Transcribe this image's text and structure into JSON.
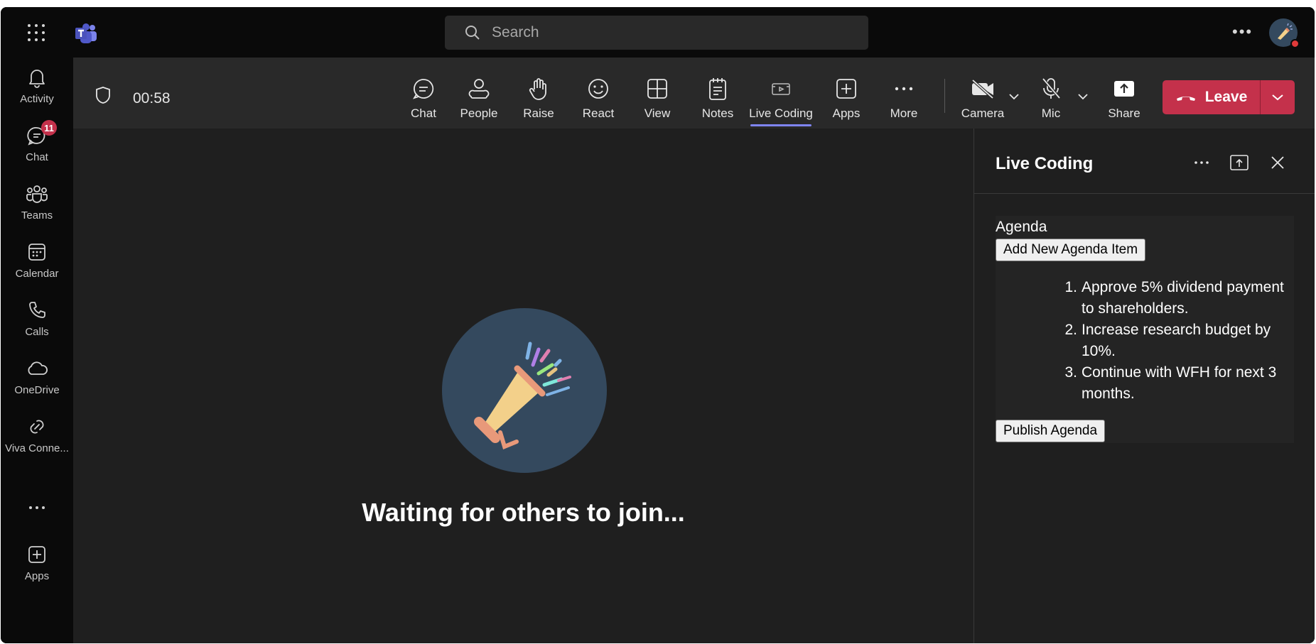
{
  "titlebar": {
    "search_placeholder": "Search"
  },
  "rail": {
    "items": [
      {
        "label": "Activity",
        "icon": "bell-icon"
      },
      {
        "label": "Chat",
        "icon": "chat-icon",
        "badge": "11"
      },
      {
        "label": "Teams",
        "icon": "teams-icon"
      },
      {
        "label": "Calendar",
        "icon": "calendar-icon"
      },
      {
        "label": "Calls",
        "icon": "phone-icon"
      },
      {
        "label": "OneDrive",
        "icon": "cloud-icon"
      },
      {
        "label": "Viva Conne...",
        "icon": "viva-connections-icon"
      },
      {
        "label": "Apps",
        "icon": "add-app-icon"
      }
    ]
  },
  "meeting": {
    "timer": "00:58",
    "tools": {
      "chat": "Chat",
      "people": "People",
      "raise": "Raise",
      "react": "React",
      "view": "View",
      "notes": "Notes",
      "live_coding": "Live Coding",
      "apps": "Apps",
      "more": "More",
      "camera": "Camera",
      "mic": "Mic",
      "share": "Share"
    },
    "leave_label": "Leave",
    "waiting_text": "Waiting for others to join..."
  },
  "panel": {
    "title": "Live Coding",
    "agenda_heading": "Agenda",
    "add_button": "Add New Agenda Item",
    "items": [
      {
        "num": "1.",
        "lines": [
          "Approve 5% dividend payment",
          "to shareholders."
        ]
      },
      {
        "num": "2.",
        "lines": [
          "Increase research budget by",
          "10%."
        ]
      },
      {
        "num": "3.",
        "lines": [
          "Continue with WFH for next 3",
          "months."
        ]
      }
    ],
    "publish_button": "Publish Agenda"
  },
  "colors": {
    "accent": "#7f85f5",
    "leave_red": "#c4314b",
    "toolbar_bg": "#292929",
    "rail_bg": "#0a0a0a",
    "stage_bg": "#1f1f1f",
    "hero_circle": "#34495e"
  }
}
